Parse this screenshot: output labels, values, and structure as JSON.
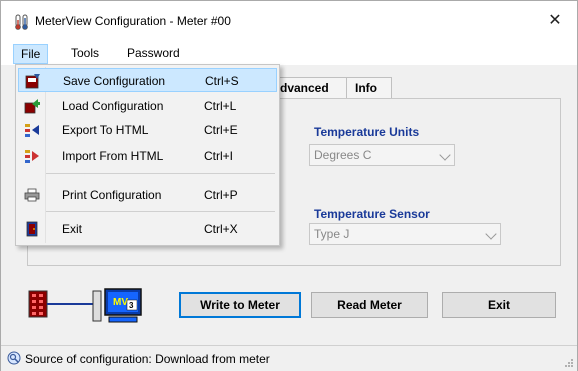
{
  "window": {
    "title": "MeterView Configuration - Meter #00",
    "close_glyph": "✕"
  },
  "menubar": {
    "items": [
      "File",
      "Tools",
      "Password"
    ],
    "open_item": "File"
  },
  "file_menu": {
    "items": [
      {
        "label": "Save Configuration",
        "shortcut": "Ctrl+S",
        "icon": "save-config-icon",
        "highlighted": true
      },
      {
        "label": "Load Configuration",
        "shortcut": "Ctrl+L",
        "icon": "load-config-icon"
      },
      {
        "label": "Export To HTML",
        "shortcut": "Ctrl+E",
        "icon": "export-html-icon"
      },
      {
        "label": "Import From HTML",
        "shortcut": "Ctrl+I",
        "icon": "import-html-icon"
      },
      {
        "label": "Print Configuration",
        "shortcut": "Ctrl+P",
        "icon": "printer-icon"
      },
      {
        "label": "Exit",
        "shortcut": "Ctrl+X",
        "icon": "exit-door-icon"
      }
    ]
  },
  "tabs": [
    "dvanced",
    "Info"
  ],
  "temperature_units": {
    "label": "Temperature Units",
    "value": "Degrees C"
  },
  "temperature_sensor": {
    "label": "Temperature Sensor",
    "value": "Type J"
  },
  "buttons": {
    "write": "Write to Meter",
    "read": "Read Meter",
    "exit": "Exit"
  },
  "graphic": {
    "monitor_text": "MV",
    "badge_text": "3"
  },
  "status": {
    "text": "Source of configuration: Download from meter"
  },
  "colors": {
    "accent": "#0078d7",
    "label_blue": "#1a3a99",
    "menu_highlight": "#cce8ff"
  }
}
